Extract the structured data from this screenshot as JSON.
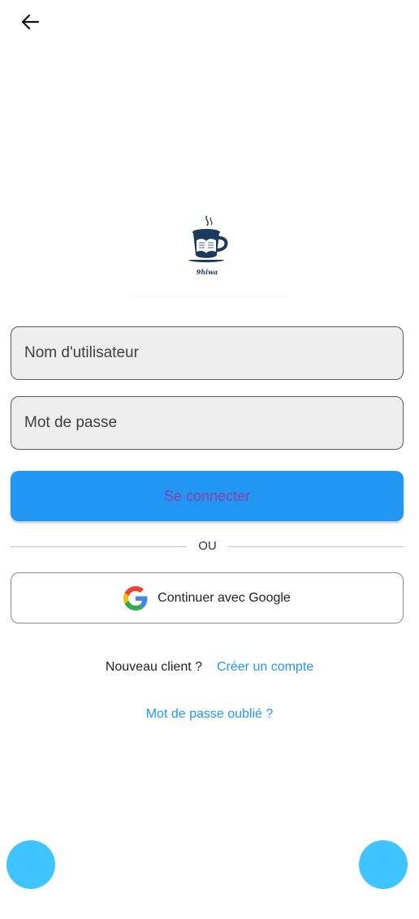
{
  "header": {
    "back_icon": "arrow-left-icon"
  },
  "logo": {
    "icon": "coffee-book-logo",
    "caption": "9hiwa",
    "color": "#1b3a5c"
  },
  "form": {
    "username": {
      "placeholder": "Nom d'utilisateur",
      "value": ""
    },
    "password": {
      "placeholder": "Mot de passe",
      "value": ""
    },
    "login_label": "Se connecter",
    "login_color": "#2196f3",
    "login_text_color": "#8c3fa6"
  },
  "divider": {
    "label": "OU"
  },
  "google": {
    "icon": "google-icon",
    "label": "Continuer avec Google"
  },
  "signup": {
    "prompt": "Nouveau client ?",
    "link": "Créer un compte",
    "link_color": "#2196f3"
  },
  "forgot": {
    "label": "Mot de passe oublié ?"
  },
  "fabs": {
    "color": "#40c4ff"
  }
}
